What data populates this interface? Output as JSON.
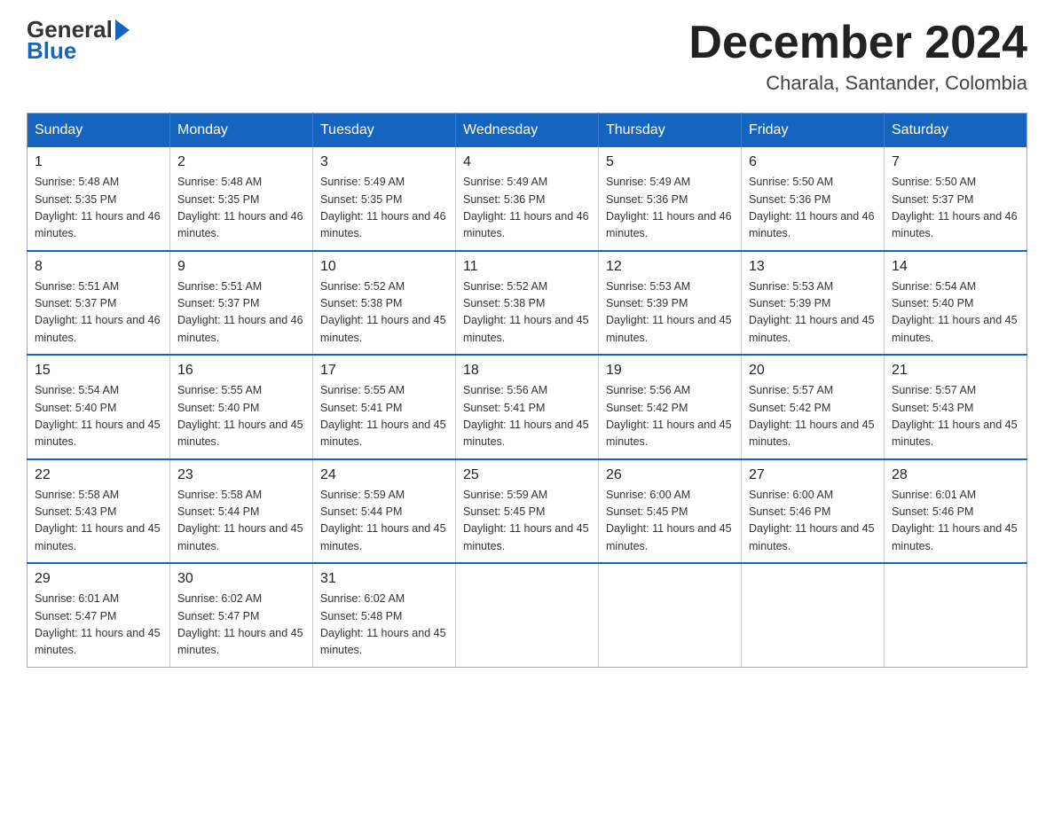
{
  "header": {
    "month_year": "December 2024",
    "location": "Charala, Santander, Colombia",
    "logo_general": "General",
    "logo_blue": "Blue"
  },
  "columns": [
    "Sunday",
    "Monday",
    "Tuesday",
    "Wednesday",
    "Thursday",
    "Friday",
    "Saturday"
  ],
  "weeks": [
    [
      {
        "day": "1",
        "sunrise": "5:48 AM",
        "sunset": "5:35 PM",
        "daylight": "11 hours and 46 minutes."
      },
      {
        "day": "2",
        "sunrise": "5:48 AM",
        "sunset": "5:35 PM",
        "daylight": "11 hours and 46 minutes."
      },
      {
        "day": "3",
        "sunrise": "5:49 AM",
        "sunset": "5:35 PM",
        "daylight": "11 hours and 46 minutes."
      },
      {
        "day": "4",
        "sunrise": "5:49 AM",
        "sunset": "5:36 PM",
        "daylight": "11 hours and 46 minutes."
      },
      {
        "day": "5",
        "sunrise": "5:49 AM",
        "sunset": "5:36 PM",
        "daylight": "11 hours and 46 minutes."
      },
      {
        "day": "6",
        "sunrise": "5:50 AM",
        "sunset": "5:36 PM",
        "daylight": "11 hours and 46 minutes."
      },
      {
        "day": "7",
        "sunrise": "5:50 AM",
        "sunset": "5:37 PM",
        "daylight": "11 hours and 46 minutes."
      }
    ],
    [
      {
        "day": "8",
        "sunrise": "5:51 AM",
        "sunset": "5:37 PM",
        "daylight": "11 hours and 46 minutes."
      },
      {
        "day": "9",
        "sunrise": "5:51 AM",
        "sunset": "5:37 PM",
        "daylight": "11 hours and 46 minutes."
      },
      {
        "day": "10",
        "sunrise": "5:52 AM",
        "sunset": "5:38 PM",
        "daylight": "11 hours and 45 minutes."
      },
      {
        "day": "11",
        "sunrise": "5:52 AM",
        "sunset": "5:38 PM",
        "daylight": "11 hours and 45 minutes."
      },
      {
        "day": "12",
        "sunrise": "5:53 AM",
        "sunset": "5:39 PM",
        "daylight": "11 hours and 45 minutes."
      },
      {
        "day": "13",
        "sunrise": "5:53 AM",
        "sunset": "5:39 PM",
        "daylight": "11 hours and 45 minutes."
      },
      {
        "day": "14",
        "sunrise": "5:54 AM",
        "sunset": "5:40 PM",
        "daylight": "11 hours and 45 minutes."
      }
    ],
    [
      {
        "day": "15",
        "sunrise": "5:54 AM",
        "sunset": "5:40 PM",
        "daylight": "11 hours and 45 minutes."
      },
      {
        "day": "16",
        "sunrise": "5:55 AM",
        "sunset": "5:40 PM",
        "daylight": "11 hours and 45 minutes."
      },
      {
        "day": "17",
        "sunrise": "5:55 AM",
        "sunset": "5:41 PM",
        "daylight": "11 hours and 45 minutes."
      },
      {
        "day": "18",
        "sunrise": "5:56 AM",
        "sunset": "5:41 PM",
        "daylight": "11 hours and 45 minutes."
      },
      {
        "day": "19",
        "sunrise": "5:56 AM",
        "sunset": "5:42 PM",
        "daylight": "11 hours and 45 minutes."
      },
      {
        "day": "20",
        "sunrise": "5:57 AM",
        "sunset": "5:42 PM",
        "daylight": "11 hours and 45 minutes."
      },
      {
        "day": "21",
        "sunrise": "5:57 AM",
        "sunset": "5:43 PM",
        "daylight": "11 hours and 45 minutes."
      }
    ],
    [
      {
        "day": "22",
        "sunrise": "5:58 AM",
        "sunset": "5:43 PM",
        "daylight": "11 hours and 45 minutes."
      },
      {
        "day": "23",
        "sunrise": "5:58 AM",
        "sunset": "5:44 PM",
        "daylight": "11 hours and 45 minutes."
      },
      {
        "day": "24",
        "sunrise": "5:59 AM",
        "sunset": "5:44 PM",
        "daylight": "11 hours and 45 minutes."
      },
      {
        "day": "25",
        "sunrise": "5:59 AM",
        "sunset": "5:45 PM",
        "daylight": "11 hours and 45 minutes."
      },
      {
        "day": "26",
        "sunrise": "6:00 AM",
        "sunset": "5:45 PM",
        "daylight": "11 hours and 45 minutes."
      },
      {
        "day": "27",
        "sunrise": "6:00 AM",
        "sunset": "5:46 PM",
        "daylight": "11 hours and 45 minutes."
      },
      {
        "day": "28",
        "sunrise": "6:01 AM",
        "sunset": "5:46 PM",
        "daylight": "11 hours and 45 minutes."
      }
    ],
    [
      {
        "day": "29",
        "sunrise": "6:01 AM",
        "sunset": "5:47 PM",
        "daylight": "11 hours and 45 minutes."
      },
      {
        "day": "30",
        "sunrise": "6:02 AM",
        "sunset": "5:47 PM",
        "daylight": "11 hours and 45 minutes."
      },
      {
        "day": "31",
        "sunrise": "6:02 AM",
        "sunset": "5:48 PM",
        "daylight": "11 hours and 45 minutes."
      },
      null,
      null,
      null,
      null
    ]
  ],
  "labels": {
    "sunrise": "Sunrise:",
    "sunset": "Sunset:",
    "daylight": "Daylight:"
  }
}
